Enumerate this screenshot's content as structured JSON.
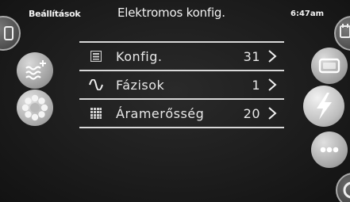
{
  "topbar": {
    "back_label": "Beállítások",
    "title": "Elektromos konfig.",
    "time": "6:47am"
  },
  "list": {
    "items": [
      {
        "icon": "config-grid-icon",
        "label": "Konfig.",
        "value": "31"
      },
      {
        "icon": "sine-wave-icon",
        "label": "Fázisok",
        "value": "1"
      },
      {
        "icon": "grid-dots-icon",
        "label": "Áramerősség",
        "value": "20"
      }
    ]
  },
  "left_buttons": [
    {
      "icon": "water-temperature-icon"
    },
    {
      "icon": "lights-ring-icon"
    }
  ],
  "right_buttons": [
    {
      "icon": "display-icon"
    },
    {
      "icon": "lightning-icon"
    },
    {
      "icon": "more-dots-icon"
    }
  ],
  "colors": {
    "background": "#1d1d1d",
    "text": "#f0f0f0",
    "divider": "#d8d8d8",
    "button": "#a8a8a8"
  }
}
